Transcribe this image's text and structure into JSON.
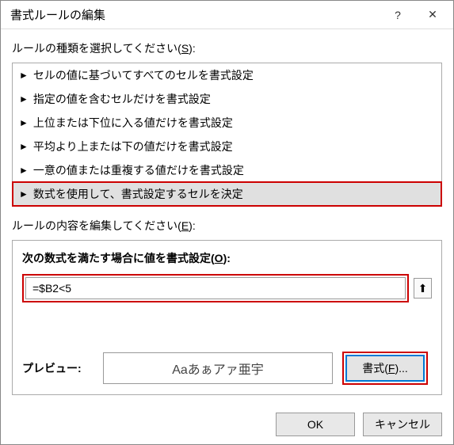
{
  "titlebar": {
    "title": "書式ルールの編集",
    "help": "?",
    "close": "✕"
  },
  "rule_type": {
    "label_pre": "ルールの種類を選択してください(",
    "label_key": "S",
    "label_post": "):",
    "items": [
      "セルの値に基づいてすべてのセルを書式設定",
      "指定の値を含むセルだけを書式設定",
      "上位または下位に入る値だけを書式設定",
      "平均より上または下の値だけを書式設定",
      "一意の値または重複する値だけを書式設定",
      "数式を使用して、書式設定するセルを決定"
    ],
    "selected_index": 5
  },
  "rule_content": {
    "label_pre": "ルールの内容を編集してください(",
    "label_key": "E",
    "label_post": "):",
    "condition_label_pre": "次の数式を満たす場合に値を書式設定(",
    "condition_label_key": "O",
    "condition_label_post": "):",
    "formula": "=$B2<5",
    "ref_icon": "⬆",
    "preview_label": "プレビュー:",
    "preview_text": "Aaあぁアァ亜宇",
    "format_button_pre": "書式(",
    "format_button_key": "F",
    "format_button_post": ")..."
  },
  "footer": {
    "ok": "OK",
    "cancel": "キャンセル"
  }
}
